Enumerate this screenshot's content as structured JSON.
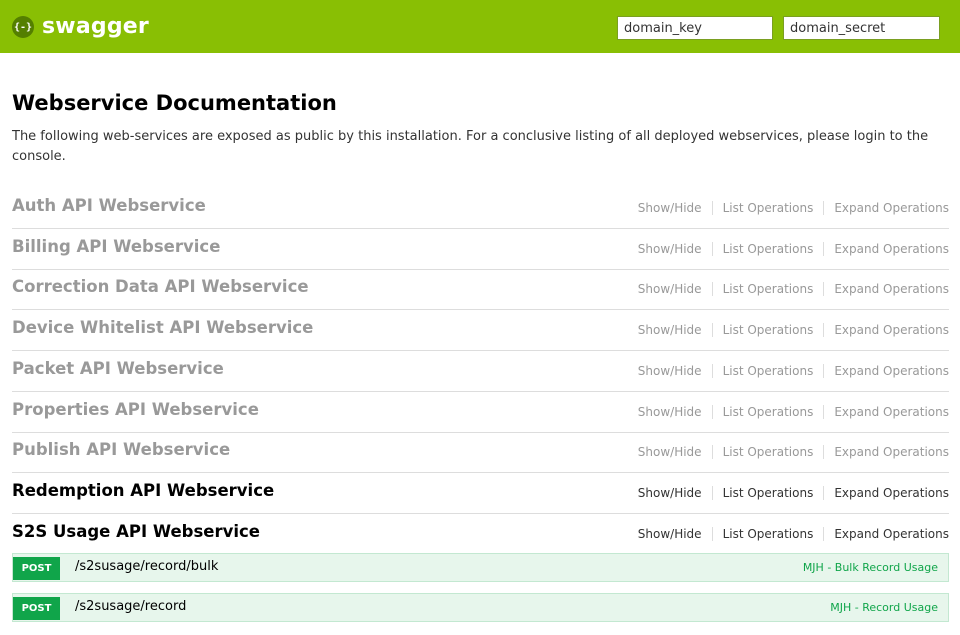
{
  "header": {
    "logo_glyph": "{-}",
    "logo_text": "swagger",
    "domain_key_placeholder": "domain_key",
    "domain_secret_placeholder": "domain_secret",
    "brand_color": "#89bf04"
  },
  "main": {
    "title": "Webservice Documentation",
    "description": "The following web-services are exposed as public by this installation. For a conclusive listing of all deployed webservices, please login to the console."
  },
  "links": {
    "show_hide": "Show/Hide",
    "list_operations": "List Operations",
    "expand_operations": "Expand Operations"
  },
  "resources": [
    {
      "name": "Auth API Webservice",
      "active": false
    },
    {
      "name": "Billing API Webservice",
      "active": false
    },
    {
      "name": "Correction Data API Webservice",
      "active": false
    },
    {
      "name": "Device Whitelist API Webservice",
      "active": false
    },
    {
      "name": "Packet API Webservice",
      "active": false
    },
    {
      "name": "Properties API Webservice",
      "active": false
    },
    {
      "name": "Publish API Webservice",
      "active": false
    },
    {
      "name": "Redemption API Webservice",
      "active": true
    },
    {
      "name": "S2S Usage API Webservice",
      "active": true
    }
  ],
  "operations": [
    {
      "method": "POST",
      "path": "/s2susage/record/bulk",
      "summary": "MJH - Bulk Record Usage"
    },
    {
      "method": "POST",
      "path": "/s2susage/record",
      "summary": "MJH - Record Usage"
    }
  ]
}
